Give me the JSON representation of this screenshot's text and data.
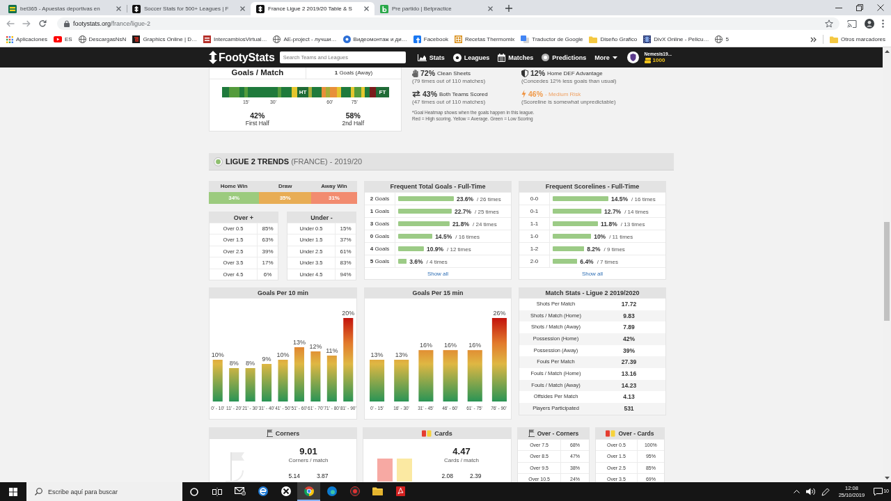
{
  "browser": {
    "tabs": [
      {
        "title": "bet365 - Apuestas deportivas en",
        "selected": false
      },
      {
        "title": "Soccer Stats for 500+ Leagues | F",
        "selected": false
      },
      {
        "title": "France Ligue 2 2019/20 Table & S",
        "selected": true
      },
      {
        "title": "Pre partido | Betpractice",
        "selected": false
      }
    ],
    "url": {
      "domain": "footystats.org",
      "path": "/france/ligue-2"
    },
    "bookmarks": [
      "Aplicaciones",
      "ES",
      "DescargasNsN",
      "Graphics Online | D…",
      "IntercambiosVirtual…",
      "AE-project - лучши…",
      "Видеомонтаж и ди…",
      "Facebook",
      "Recetas Thermomix",
      "Traductor de Google",
      "Diseño Grafico",
      "DivX Online - Pelicu…",
      "5"
    ],
    "other_bookmarks": "Otros marcadores"
  },
  "site_nav": {
    "logo": "FootyStats",
    "search_placeholder": "Search Teams and Leagues",
    "links": [
      {
        "label": "Stats",
        "kind": "link"
      },
      {
        "label": "Leagues",
        "kind": "link"
      },
      {
        "label": "Matches",
        "kind": "link"
      },
      {
        "label": "Predictions",
        "kind": "link"
      },
      {
        "label": "More",
        "kind": "dropdown"
      }
    ],
    "user": {
      "name": "Nemesis19...",
      "coins": "1000"
    }
  },
  "goals_card": {
    "title": "Goals / Match",
    "away": "**1** Goals (Away)",
    "heatmap": {
      "half_time": "HT",
      "full_time": "FT",
      "ticks_first_half": [
        "15'",
        "30'"
      ],
      "ticks_second_half": [
        "60'",
        "75'"
      ]
    },
    "halves": [
      {
        "value": "42%",
        "label": "First Half"
      },
      {
        "value": "58%",
        "label": "2nd Half"
      }
    ]
  },
  "summary_stats": [
    {
      "kind": "stat",
      "value": "72%",
      "label": "Clean Sheets",
      "detail": "(79 times out of 110 matches)"
    },
    {
      "kind": "stat",
      "value": "12%",
      "label": "Home DEF Advantage",
      "detail": "(Concedes 12% less goals than usual)"
    },
    {
      "kind": "stat",
      "value": "43%",
      "label": "Both Teams Scored",
      "detail": "(47 times out of 110 matches)"
    },
    {
      "kind": "risk",
      "value": "46%",
      "label": "- Medium Risk",
      "detail": "(Scoreline is somewhat unpredictable)"
    }
  ],
  "heatmap_note": [
    "*Goal Heatmap shows when the goals happen in this league.",
    "Red = High scoring. Yellow = Average. Green = Low Scoring"
  ],
  "trends": {
    "title": "**LIGUE 2 TRENDS** (FRANCE) - 2019/20",
    "result_split": [
      {
        "label": "Home Win",
        "value": "34%",
        "level": 0.34,
        "color": "#9ccb7e"
      },
      {
        "label": "Draw",
        "value": "35%",
        "level": 0.35,
        "color": "#e8ad55"
      },
      {
        "label": "Away Win",
        "value": "31%",
        "level": 0.31,
        "color": "#f28b6f"
      }
    ],
    "over": {
      "title": "Over +",
      "rows": [
        {
          "label": "Over 0.5",
          "value": "85%"
        },
        {
          "label": "Over 1.5",
          "value": "63%"
        },
        {
          "label": "Over 2.5",
          "value": "39%"
        },
        {
          "label": "Over 3.5",
          "value": "17%"
        },
        {
          "label": "Over 4.5",
          "value": "6%"
        }
      ]
    },
    "under": {
      "title": "Under -",
      "rows": [
        {
          "label": "Under 0.5",
          "value": "15%"
        },
        {
          "label": "Under 1.5",
          "value": "37%"
        },
        {
          "label": "Under 2.5",
          "value": "61%"
        },
        {
          "label": "Under 3.5",
          "value": "83%"
        },
        {
          "label": "Under 4.5",
          "value": "94%"
        }
      ]
    },
    "total_goals": {
      "chart_data": {
        "type": "bar",
        "orientation": "horizontal",
        "title": "Frequent Total Goals - Full-Time",
        "categories": [
          "**2** Goals",
          "**1** Goals",
          "**3** Goals",
          "**0** Goals",
          "**4** Goals",
          "**5** Goals"
        ],
        "values": [
          23.6,
          22.7,
          21.8,
          14.5,
          10.9,
          3.6
        ],
        "value_labels": [
          "23.6%",
          "22.7%",
          "21.8%",
          "14.5%",
          "10.9%",
          "3.6%"
        ]
      },
      "counts": [
        "/ 26 times",
        "/ 25 times",
        "/ 24 times",
        "/ 16 times",
        "/ 12 times",
        "/ 4 times"
      ],
      "link": "Show all"
    },
    "scorelines": {
      "chart_data": {
        "type": "bar",
        "orientation": "horizontal",
        "title": "Frequent Scorelines - Full-Time",
        "categories": [
          "0-0",
          "0-1",
          "1-1",
          "1-0",
          "1-2",
          "2-0"
        ],
        "values": [
          14.5,
          12.7,
          11.8,
          10,
          8.2,
          6.4
        ],
        "value_labels": [
          "14.5%",
          "12.7%",
          "11.8%",
          "10%",
          "8.2%",
          "6.4%"
        ]
      },
      "counts": [
        "/ 16 times",
        "/ 14 times",
        "/ 13 times",
        "/ 11 times",
        "/ 9 times",
        "/ 7 times"
      ],
      "link": "Show all"
    },
    "goals_10": {
      "chart_data": {
        "type": "bar",
        "title": "Goals Per 10 min",
        "categories": [
          "0' - 10'",
          "11' - 20'",
          "21' - 30'",
          "31' - 40'",
          "41' - 50'",
          "51' - 60'",
          "61' - 70'",
          "71' - 80'",
          "81' - 90'"
        ],
        "values": [
          10,
          8,
          8,
          9,
          10,
          13,
          12,
          11,
          20
        ],
        "value_labels": [
          "10%",
          "8%",
          "8%",
          "9%",
          "10%",
          "13%",
          "12%",
          "11%",
          "20%"
        ]
      }
    },
    "goals_15": {
      "chart_data": {
        "type": "bar",
        "title": "Goals Per 15 min",
        "categories": [
          "0' - 15'",
          "16' - 30'",
          "31' - 45'",
          "46' - 60'",
          "61' - 75'",
          "76' - 90'"
        ],
        "values": [
          13,
          13,
          16,
          16,
          16,
          26
        ],
        "value_labels": [
          "13%",
          "13%",
          "16%",
          "16%",
          "16%",
          "26%"
        ]
      }
    },
    "match_stats": {
      "title": "Match Stats - Ligue 2 2019/2020",
      "rows": [
        {
          "label": "Shots Per Match",
          "value": "17.72"
        },
        {
          "label": "Shots / Match (Home)",
          "value": "9.83"
        },
        {
          "label": "Shots / Match (Away)",
          "value": "7.89"
        },
        {
          "label": "Possession (Home)",
          "value": "42%"
        },
        {
          "label": "Possession (Away)",
          "value": "39%"
        },
        {
          "label": "Fouls Per Match",
          "value": "27.39"
        },
        {
          "label": "Fouls / Match (Home)",
          "value": "13.16"
        },
        {
          "label": "Fouls / Match (Away)",
          "value": "14.23"
        },
        {
          "label": "Offsides Per Match",
          "value": "4.13"
        },
        {
          "label": "Players Participated",
          "value": "531"
        }
      ]
    },
    "corners": {
      "title": "Corners",
      "value": "9.01",
      "label": "Corners / match",
      "split": [
        "5.14",
        "3.87"
      ]
    },
    "cards": {
      "title": "Cards",
      "value": "4.47",
      "label": "Cards / match",
      "split": [
        "2.08",
        "2.39"
      ]
    },
    "over_corners": {
      "title": "Over - Corners",
      "rows": [
        {
          "label": "Over 7.5",
          "value": "68%"
        },
        {
          "label": "Over 8.5",
          "value": "47%"
        },
        {
          "label": "Over 9.5",
          "value": "38%"
        },
        {
          "label": "Over 10.5",
          "value": "24%"
        }
      ]
    },
    "over_cards": {
      "title": "Over - Cards",
      "rows": [
        {
          "label": "Over 0.5",
          "value": "100%"
        },
        {
          "label": "Over 1.5",
          "value": "95%"
        },
        {
          "label": "Over 2.5",
          "value": "85%"
        },
        {
          "label": "Over 3.5",
          "value": "69%"
        }
      ]
    }
  },
  "taskbar": {
    "search_placeholder": "Escribe aquí para buscar",
    "apps": [
      {
        "selected": false
      },
      {
        "selected": false
      },
      {
        "selected": false
      },
      {
        "selected": true
      },
      {
        "selected": false
      },
      {
        "selected": false
      },
      {
        "selected": false
      },
      {
        "selected": false
      }
    ],
    "clock": {
      "time": "12:08",
      "date": "25/10/2019"
    },
    "notifications": "10"
  }
}
